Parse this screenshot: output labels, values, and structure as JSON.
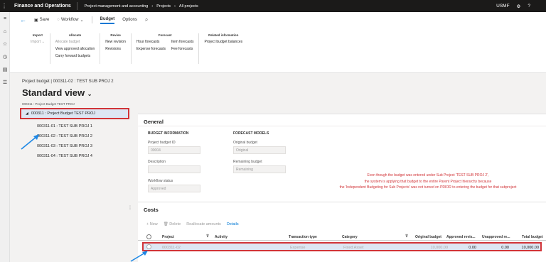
{
  "topbar": {
    "app_title": "Finance and Operations",
    "breadcrumbs": [
      "Project management and accounting",
      "Projects",
      "All projects"
    ],
    "company": "USMF"
  },
  "toolbar": {
    "save": "Save",
    "workflow": "Workflow",
    "tabs": [
      "Budget",
      "Options"
    ]
  },
  "groups": {
    "import": {
      "title": "Import",
      "items": [
        "Import"
      ]
    },
    "allocate": {
      "title": "Allocate",
      "items": [
        "Allocate budget",
        "View approved allocation",
        "Carry forward budgets"
      ]
    },
    "revise": {
      "title": "Revise",
      "items": [
        "New revision",
        "Revisions"
      ]
    },
    "forecast": {
      "title": "Forecast",
      "col1": [
        "Hour forecasts",
        "Expense forecasts"
      ],
      "col2": [
        "Item forecasts",
        "Fee forecasts"
      ]
    },
    "related": {
      "title": "Related information",
      "items": [
        "Project budget balances"
      ]
    }
  },
  "page": {
    "caption": "Project budget  |  000311-02 : TEST SUB PROJ 2",
    "title": "Standard view",
    "subtitle": "000311 : Project Budget TEST PROJ"
  },
  "tree": {
    "root": "000311 : Project Budget TEST PROJ",
    "children": [
      "000311-01 : TEST SUB PROJ 1",
      "000311-02 : TEST SUB PROJ 2",
      "000311-03 : TEST SUB PROJ 3",
      "000311-04 : TEST SUB PROJ 4"
    ]
  },
  "general": {
    "title": "General",
    "budget_info_title": "BUDGET INFORMATION",
    "forecast_models_title": "FORECAST MODELS",
    "project_budget_id_label": "Project budget ID",
    "project_budget_id_value": "00004",
    "description_label": "Description",
    "description_value": "",
    "workflow_status_label": "Workflow status",
    "workflow_status_value": "Approved",
    "original_budget_label": "Original budget",
    "original_budget_value": "Original",
    "remaining_budget_label": "Remaining budget",
    "remaining_budget_value": "Remaining",
    "note_lines": [
      "Even though the budget was entered under Sub Project 'TEST SUB PROJ 2',",
      "the system is applying that budget to the entire Parent Project hierarchy because",
      "the 'Independent Budgeting for Sub Projects' was not turned on PRIOR to entering the budget for that subproject"
    ]
  },
  "costs": {
    "title": "Costs",
    "actions": {
      "new": "New",
      "delete": "Delete",
      "reallocate": "Reallocate amounts",
      "details": "Details"
    },
    "columns": [
      "Project",
      "Activity",
      "Transaction type",
      "Category",
      "Original budget",
      "Approved revis...",
      "Unapproved re...",
      "Total budget"
    ],
    "row": {
      "project": "000311-02",
      "activity": "",
      "transaction_type": "Expense",
      "category": "Fixed Asset",
      "original_budget": "10,000.00",
      "approved_revisions": "0.00",
      "unapproved_revisions": "0.00",
      "total_budget": "10,000.00"
    }
  },
  "colors": {
    "topbar": "#1b1a19",
    "accent": "#0078d4",
    "highlight_border": "#d13438",
    "selection": "#dde6f3",
    "annotation_arrow": "#1e88e5"
  }
}
